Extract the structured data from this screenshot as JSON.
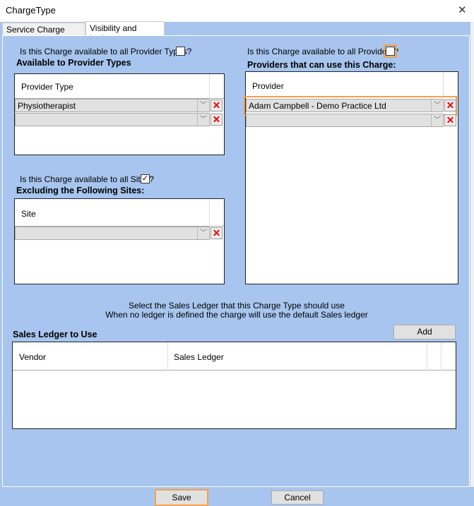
{
  "window": {
    "title": "ChargeType",
    "close_icon": "close-icon"
  },
  "tabs": [
    {
      "label": "Service Charge Details",
      "selected": false
    },
    {
      "label": "Visibility and Ledgers",
      "selected": true
    }
  ],
  "provider_types": {
    "question": "Is this Charge available to all Provider Types?",
    "checked": false,
    "heading": "Available to Provider Types",
    "column": "Provider Type",
    "rows": [
      "Physiotherapist",
      ""
    ]
  },
  "sites": {
    "question": "Is this Charge available to all Sites?",
    "checked": true,
    "heading": "Excluding the Following Sites:",
    "column": "Site",
    "rows": [
      ""
    ]
  },
  "providers": {
    "question": "Is this Charge available to all Providers?",
    "checked": false,
    "heading": "Providers that can use this Charge:",
    "column": "Provider",
    "rows": [
      "Adam  Campbell - Demo Practice Ltd",
      ""
    ]
  },
  "ledger": {
    "info_line1": "Select the Sales Ledger that this Charge Type should use",
    "info_line2": "When no ledger is defined the charge will use the default Sales ledger",
    "heading": "Sales Ledger to Use",
    "add_label": "Add",
    "columns": [
      "Vendor",
      "Sales Ledger"
    ]
  },
  "footer": {
    "save_label": "Save",
    "cancel_label": "Cancel"
  },
  "colors": {
    "background": "#a7c5ee",
    "highlight": "#f5a04a",
    "delete": "#e00000"
  }
}
